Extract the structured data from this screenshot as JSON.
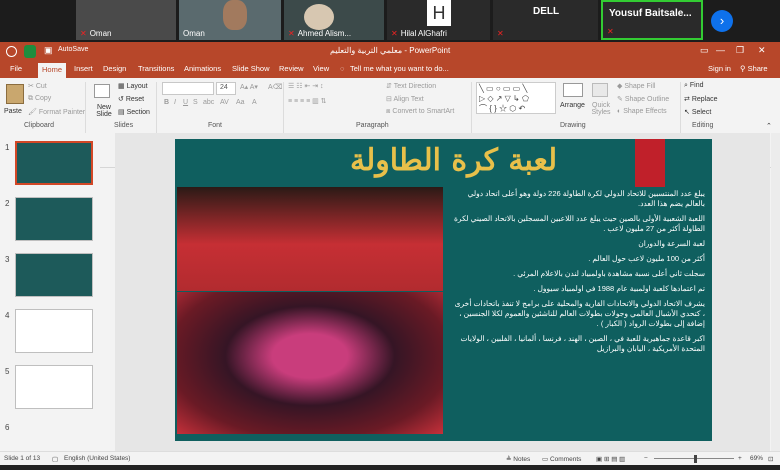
{
  "zoom": {
    "participants": [
      "Oman",
      "Oman",
      "Ahmed Alism...",
      "Hilal AlGhafri",
      "DELL",
      "Yousuf Baitsale..."
    ],
    "avatar_letter": "H"
  },
  "app": {
    "title": "معلمي التربية والتعليم - PowerPoint",
    "autosave": "AutoSave",
    "signin": "Sign in",
    "share": "Share",
    "tell_me": "Tell me what you want to do..."
  },
  "tabs": [
    "File",
    "Home",
    "Insert",
    "Design",
    "Transitions",
    "Animations",
    "Slide Show",
    "Review",
    "View"
  ],
  "ribbon": {
    "paste": "Paste",
    "cut": "Cut",
    "copy": "Copy",
    "format_painter": "Format Painter",
    "clipboard": "Clipboard",
    "new_slide": "New Slide",
    "layout": "Layout",
    "reset": "Reset",
    "section": "Section",
    "slides": "Slides",
    "font_size": "24",
    "font": "Font",
    "text_direction": "Text Direction",
    "align_text": "Align Text",
    "convert_smartart": "Convert to SmartArt",
    "paragraph": "Paragraph",
    "arrange": "Arrange",
    "quick_styles": "Quick Styles",
    "shape_fill": "Shape Fill",
    "shape_outline": "Shape Outline",
    "shape_effects": "Shape Effects",
    "drawing": "Drawing",
    "find": "Find",
    "replace": "Replace",
    "select": "Select",
    "editing": "Editing"
  },
  "thumb_numbers": [
    "1",
    "2",
    "3",
    "4",
    "5",
    "6"
  ],
  "slide": {
    "title": "لعبة كرة الطاولة",
    "bullets": [
      "يبلغ عدد المنتسبين للاتحاد الدولي لكرة الطاولة 226 دولة وهو أعلى اتحاد دولي بالعالم يضم هذا العدد.",
      "اللعبة الشعبية الأولى بالصين حيث يبلغ عدد اللاعبين المسجلين بالاتحاد الصيني لكرة الطاولة أكثر من 27 مليون لاعب .",
      "لعبة السرعة والدوران",
      "أكثر من 100 مليون لاعب حول العالم .",
      "سجلت ثاني أعلى نسبة مشاهدة باولمبياد لندن بالاعلام المرئي .",
      "تم اعتمادها كلعبة اولمبية عام 1988 في اولمبياد سيوول .",
      "يشرف الاتحاد الدولي والاتحادات القارية والمحلية على برامج لا تنفذ باتحادات أخرى ، كتحدي الأشبال العالمي وجولات بطولات العالم للناشئين والعموم لكلا الجنسين ، إضافة إلى بطولات الرواد ( الكبار ) .",
      "اكبر قاعدة جماهيرية للعبة في ، الصين ، الهند ، فرنسا ، ألمانيا ، الفلبين ، الولايات المتحدة الأمريكية ، اليابان والبرازيل"
    ]
  },
  "status": {
    "slide_of": "Slide 1 of 13",
    "language": "English (United States)",
    "notes": "Notes",
    "comments": "Comments",
    "zoom": "69%"
  }
}
